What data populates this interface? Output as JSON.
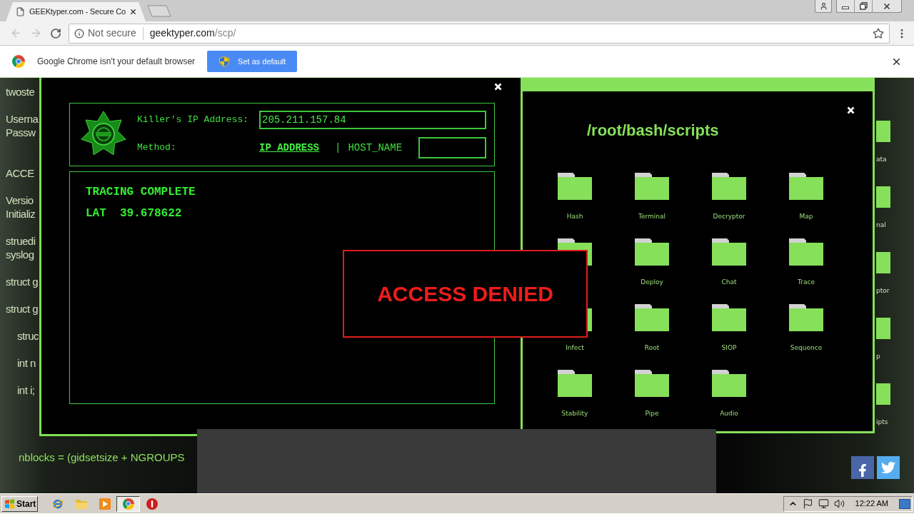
{
  "browser": {
    "tabs": [
      {
        "title": "GEEKtyper.com - Secure Co",
        "selected": true
      }
    ],
    "toolbar": {
      "back": {
        "disabled": true
      },
      "forward": {
        "disabled": true
      },
      "security_label": "Not secure",
      "url_host": "geektyper.com",
      "url_path": "/scp/"
    },
    "infobar": {
      "message": "Google Chrome isn't your default browser",
      "button": "Set as default"
    }
  },
  "page": {
    "background_blocks": [
      {
        "paragraphs": [
          {
            "lines": [
              "twoste"
            ]
          },
          {
            "lines": [
              "Userna",
              "Passw"
            ]
          }
        ]
      },
      {
        "paragraphs": [
          {
            "lines": [
              "ACCE"
            ]
          },
          {
            "lines": [
              "Versio",
              "Initializ"
            ]
          },
          {
            "lines": [
              "struedi",
              "syslog"
            ]
          },
          {
            "lines": [
              "struct g"
            ]
          },
          {
            "lines": [
              "struct g"
            ],
            "children": [
              {
                "lines": [
                  "struc"
                ]
              },
              {
                "lines": [
                  "int n"
                ]
              },
              {
                "lines": [
                  "int i;"
                ]
              }
            ]
          }
        ]
      }
    ],
    "background_bottom_line": "nblocks = (gidsetsize + NGROUPS",
    "background_folders": [
      {
        "label": "ata"
      },
      {
        "label": "nal"
      },
      {
        "label": "ptor"
      },
      {
        "label": "p"
      },
      {
        "label": "ipts"
      }
    ],
    "trace_window": {
      "ip_label": "Killer's IP Address:",
      "ip_value": "205.211.157.84",
      "method_label": "Method:",
      "methods": [
        {
          "label": "IP_ADDRESS",
          "selected": true
        },
        {
          "label": "HOST_NAME",
          "selected": false
        }
      ],
      "separator": "|",
      "status": "TRACING COMPLETE",
      "latitude": "LAT  39.678622"
    },
    "scripts_window": {
      "title": "/root/bash/scripts",
      "folders": [
        {
          "kind": "folder",
          "label": "Hash"
        },
        {
          "kind": "folder",
          "label": "Terminal"
        },
        {
          "kind": "folder",
          "label": "Decryptor"
        },
        {
          "kind": "folder",
          "label": "Map"
        },
        {
          "kind": "folder"
        },
        {
          "kind": "folder",
          "label": "Deploy"
        },
        {
          "kind": "folder",
          "label": "Chat"
        },
        {
          "kind": "folder",
          "label": "Trace"
        },
        {
          "kind": "folder",
          "label": "Infect"
        },
        {
          "kind": "folder",
          "label": "Root"
        },
        {
          "kind": "folder",
          "label": "SIOP"
        },
        {
          "kind": "folder",
          "label": "Sequence"
        },
        {
          "kind": "folder",
          "label": "Stability"
        },
        {
          "kind": "folder",
          "label": "Pipe"
        },
        {
          "kind": "folder",
          "label": "Audio"
        }
      ]
    },
    "alert": "ACCESS DENIED"
  },
  "taskbar": {
    "start": "Start",
    "apps": [
      {
        "kind": "ie",
        "selected": false
      },
      {
        "kind": "explorer",
        "selected": false
      },
      {
        "kind": "media",
        "selected": false
      },
      {
        "kind": "chrome",
        "selected": true
      },
      {
        "kind": "stop",
        "selected": false
      }
    ],
    "clock": "12:22 AM"
  }
}
